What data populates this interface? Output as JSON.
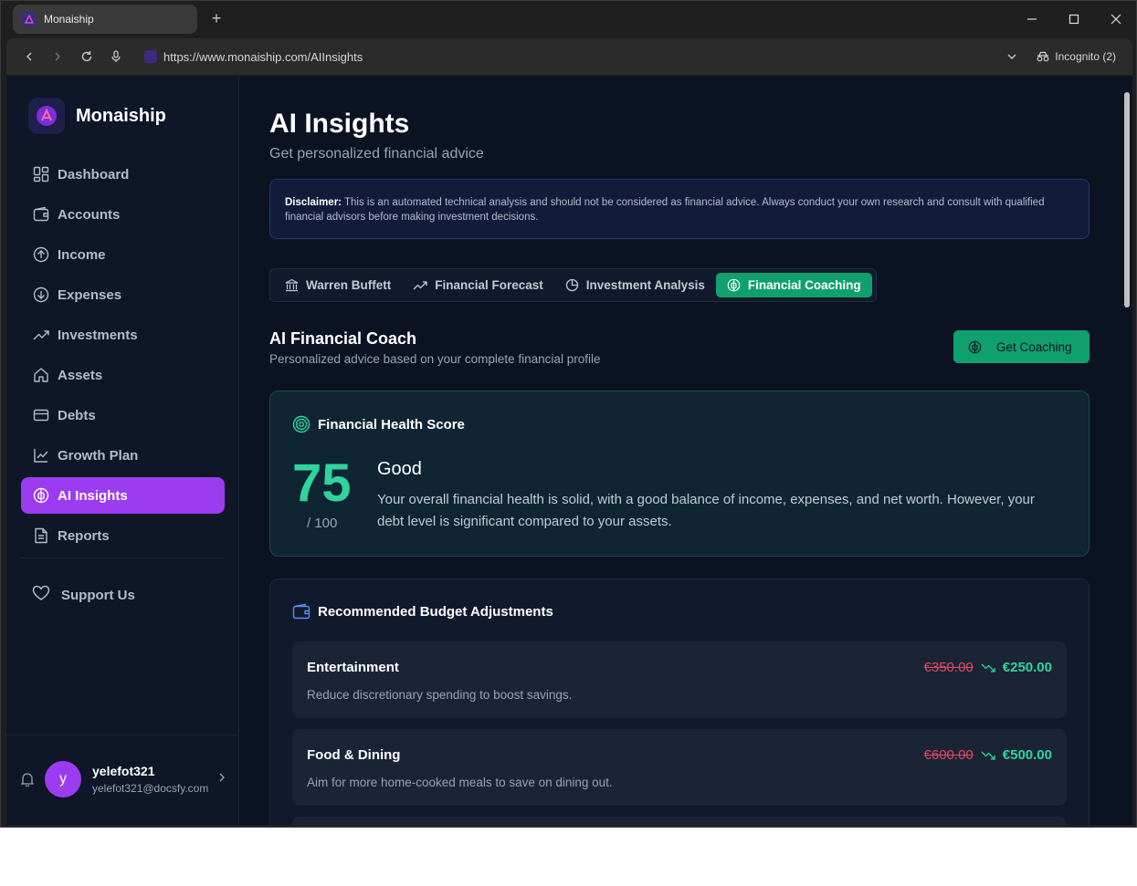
{
  "browser": {
    "tab_title": "Monaiship",
    "new_tab": "+",
    "url": "https://www.monaiship.com/AIInsights",
    "incognito": "Incognito (2)"
  },
  "brand": {
    "name": "Monaiship",
    "accent": "#9b3cf0"
  },
  "sidebar": {
    "items": [
      {
        "label": "Dashboard",
        "icon": "grid-icon"
      },
      {
        "label": "Accounts",
        "icon": "wallet-icon"
      },
      {
        "label": "Income",
        "icon": "arrow-up-circle-icon"
      },
      {
        "label": "Expenses",
        "icon": "arrow-down-circle-icon"
      },
      {
        "label": "Investments",
        "icon": "trending-up-icon"
      },
      {
        "label": "Assets",
        "icon": "home-icon"
      },
      {
        "label": "Debts",
        "icon": "credit-card-icon"
      },
      {
        "label": "Growth Plan",
        "icon": "line-chart-icon"
      },
      {
        "label": "AI Insights",
        "icon": "brain-icon",
        "active": true
      },
      {
        "label": "Reports",
        "icon": "document-icon"
      }
    ],
    "support": "Support Us",
    "user": {
      "initial": "y",
      "name": "yelefot321",
      "email": "yelefot321@docsfy.com"
    }
  },
  "main": {
    "title": "AI Insights",
    "subtitle": "Get personalized financial advice",
    "disclaimer_label": "Disclaimer:",
    "disclaimer_text": " This is an automated technical analysis and should not be considered as financial advice. Always conduct your own research and consult with qualified financial advisors before making investment decisions.",
    "tabs": [
      {
        "label": "Warren Buffett",
        "icon": "bank-icon"
      },
      {
        "label": "Financial Forecast",
        "icon": "trending-up-icon"
      },
      {
        "label": "Investment Analysis",
        "icon": "pie-chart-icon"
      },
      {
        "label": "Financial Coaching",
        "icon": "brain-icon",
        "active": true
      }
    ],
    "coach_title": "AI Financial Coach",
    "coach_subtitle": "Personalized advice based on your complete financial profile",
    "get_coaching": "Get Coaching",
    "health": {
      "title": "Financial Health Score",
      "score": "75",
      "max": "/ 100",
      "label": "Good",
      "description": "Your overall financial health is solid, with a good balance of income, expenses, and net worth. However, your debt level is significant compared to your assets."
    },
    "budget": {
      "title": "Recommended Budget Adjustments",
      "items": [
        {
          "category": "Entertainment",
          "description": "Reduce discretionary spending to boost savings.",
          "old": "€350.00",
          "new": "€250.00"
        },
        {
          "category": "Food & Dining",
          "description": "Aim for more home-cooked meals to save on dining out.",
          "old": "€600.00",
          "new": "€500.00"
        }
      ]
    }
  },
  "colors": {
    "green": "#2fd59b",
    "red": "#e5485f",
    "button_green": "#10a06e"
  }
}
